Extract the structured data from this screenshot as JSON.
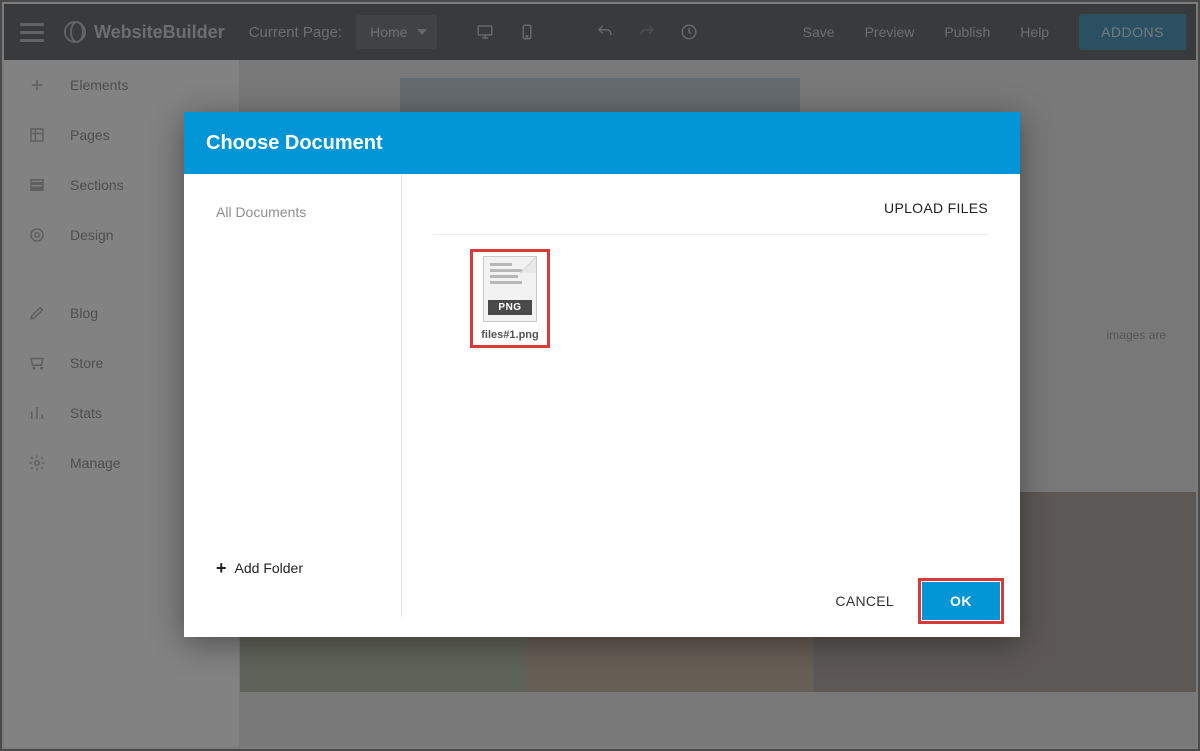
{
  "topbar": {
    "brand": "WebsiteBuilder",
    "current_page_label": "Current Page:",
    "page_selected": "Home",
    "actions": [
      "Save",
      "Preview",
      "Publish",
      "Help"
    ],
    "addons": "ADDONS"
  },
  "sidebar": {
    "items": [
      "Elements",
      "Pages",
      "Sections",
      "Design",
      "Blog",
      "Store",
      "Stats",
      "Manage"
    ]
  },
  "canvas": {
    "hint": "images are"
  },
  "modal": {
    "title": "Choose Document",
    "sidebar": {
      "items": [
        "All Documents"
      ],
      "add_folder": "Add Folder"
    },
    "upload_label": "UPLOAD FILES",
    "files": [
      {
        "name": "files#1.png",
        "ext": "PNG",
        "selected": true
      }
    ],
    "cancel": "CANCEL",
    "ok": "OK"
  },
  "colors": {
    "accent": "#0296d6",
    "highlight": "#d83a3a"
  }
}
